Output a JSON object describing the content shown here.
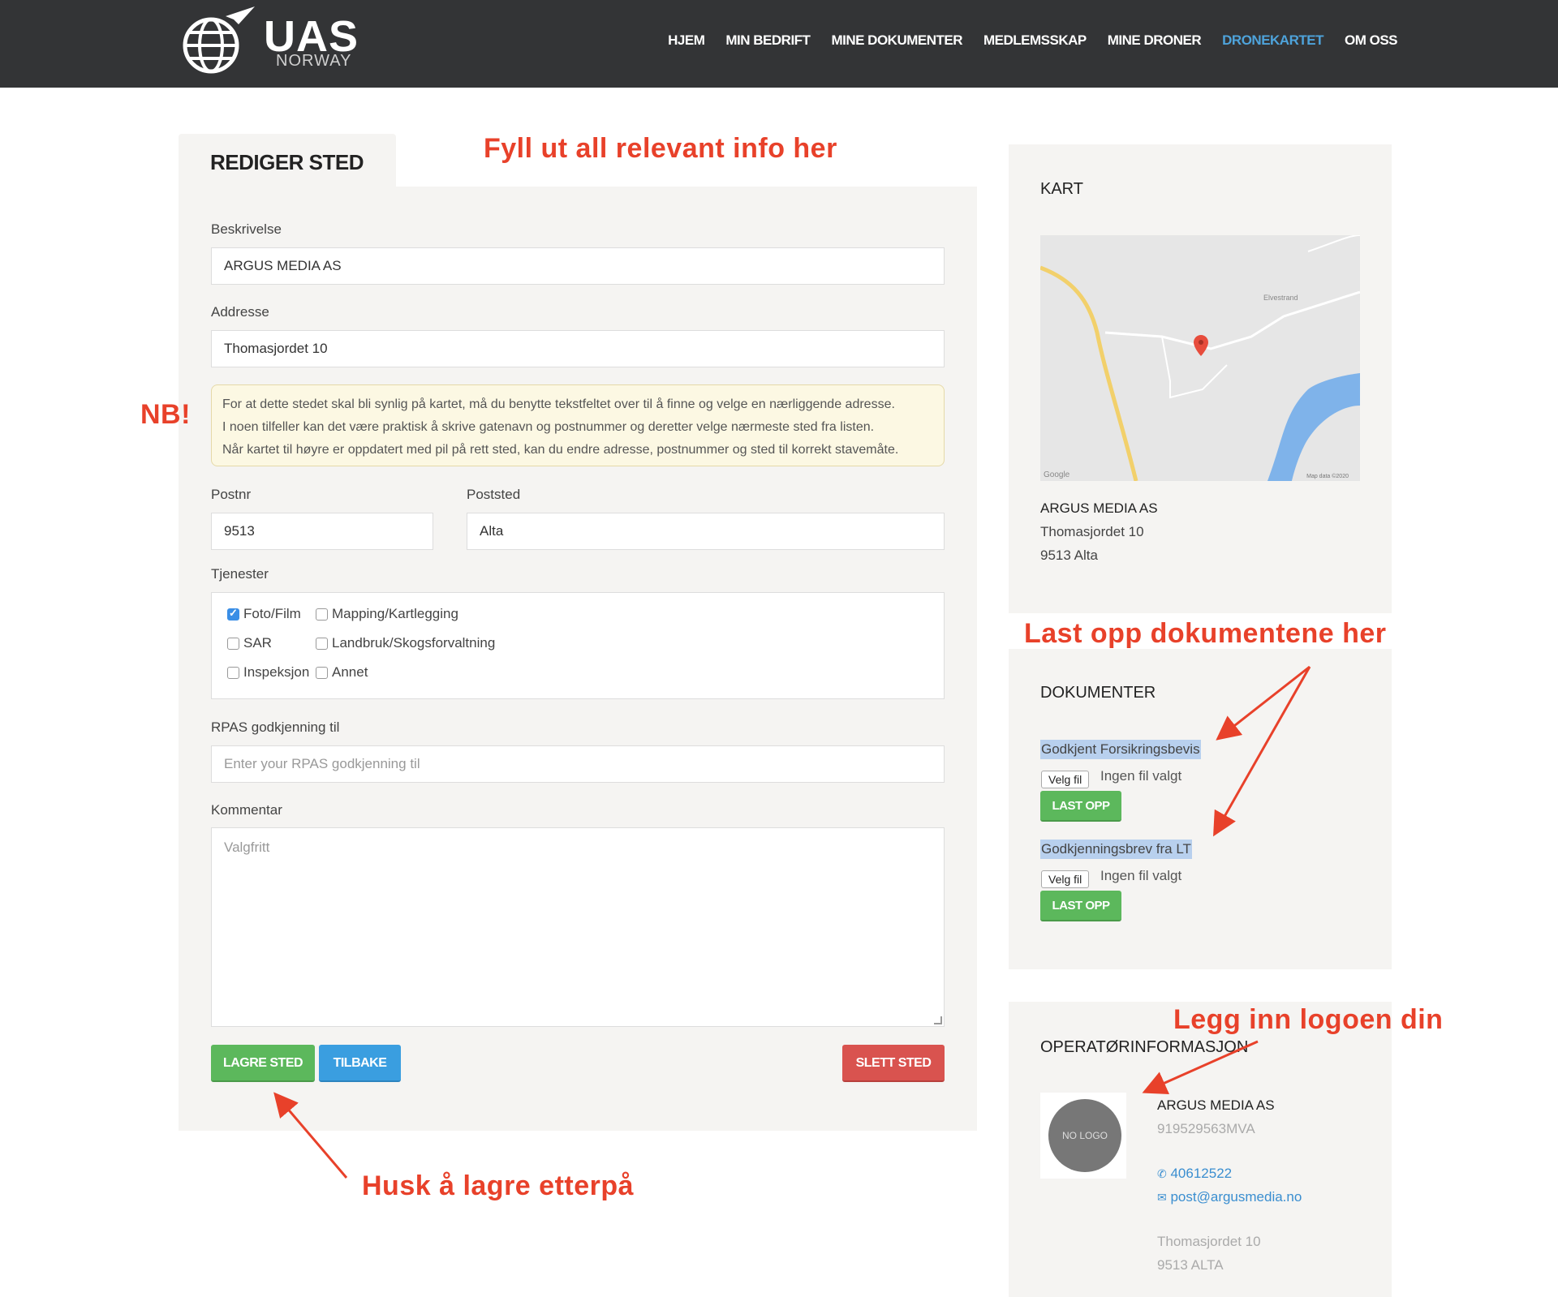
{
  "header": {
    "logo_text": "UAS",
    "logo_sub": "NORWAY",
    "nav": [
      {
        "label": "HJEM"
      },
      {
        "label": "MIN BEDRIFT"
      },
      {
        "label": "MINE DOKUMENTER"
      },
      {
        "label": "MEDLEMSSKAP"
      },
      {
        "label": "MINE DRONER"
      },
      {
        "label": "DRONEKARTET",
        "active": true
      },
      {
        "label": "OM OSS"
      }
    ]
  },
  "form": {
    "tab_title": "REDIGER STED",
    "description_label": "Beskrivelse",
    "description_value": "ARGUS MEDIA AS",
    "address_label": "Addresse",
    "address_value": "Thomasjordet 10",
    "notice_lines": [
      "For at dette stedet skal bli synlig på kartet, må du benytte tekstfeltet over til å finne og velge en nærliggende adresse.",
      "I noen tilfeller kan det være praktisk å skrive gatenavn og postnummer og deretter velge nærmeste sted fra listen.",
      "Når kartet til høyre er oppdatert med pil på rett sted, kan du endre adresse, postnummer og sted til korrekt stavemåte."
    ],
    "postnr_label": "Postnr",
    "postnr_value": "9513",
    "poststed_label": "Poststed",
    "poststed_value": "Alta",
    "services_label": "Tjenester",
    "services": [
      {
        "label": "Foto/Film",
        "checked": true
      },
      {
        "label": "Mapping/Kartlegging",
        "checked": false
      },
      {
        "label": "SAR",
        "checked": false
      },
      {
        "label": "Landbruk/Skogsforvaltning",
        "checked": false
      },
      {
        "label": "Inspeksjon",
        "checked": false
      },
      {
        "label": "Annet",
        "checked": false
      }
    ],
    "rpas_label": "RPAS godkjenning til",
    "rpas_placeholder": "Enter your RPAS godkjenning til",
    "comment_label": "Kommentar",
    "comment_placeholder": "Valgfritt",
    "save_button": "LAGRE STED",
    "back_button": "TILBAKE",
    "delete_button": "SLETT STED"
  },
  "map_panel": {
    "title": "KART",
    "map_labels": {
      "place": "Elvestrand",
      "brand": "Google",
      "credit": "Map data ©2020"
    },
    "name": "ARGUS MEDIA AS",
    "street": "Thomasjordet 10",
    "city": "9513 Alta"
  },
  "documents_panel": {
    "title": "DOKUMENTER",
    "docs": [
      {
        "label": "Godkjent Forsikringsbevis",
        "file_button": "Velg fil",
        "file_status": "Ingen fil valgt",
        "upload_button": "LAST OPP"
      },
      {
        "label": "Godkjenningsbrev fra LT",
        "file_button": "Velg fil",
        "file_status": "Ingen fil valgt",
        "upload_button": "LAST OPP"
      }
    ]
  },
  "operator_panel": {
    "title": "OPERATØRINFORMASJON",
    "logo_placeholder": "NO LOGO",
    "name": "ARGUS MEDIA AS",
    "org": "919529563MVA",
    "phone": "40612522",
    "email": "post@argusmedia.no",
    "street": "Thomasjordet 10",
    "city": "9513 ALTA"
  },
  "annotations": {
    "fill_info": "Fyll ut all relevant info her",
    "nb": "NB!",
    "upload_docs": "Last opp dokumentene her",
    "logo": "Legg inn logoen din",
    "save_reminder": "Husk å lagre etterpå"
  },
  "colors": {
    "header_bg": "#333436",
    "nav_active": "#4ea3db",
    "annotation": "#e8412a",
    "green": "#5cb85c",
    "blue": "#3a9ee0",
    "red": "#d9534f"
  }
}
